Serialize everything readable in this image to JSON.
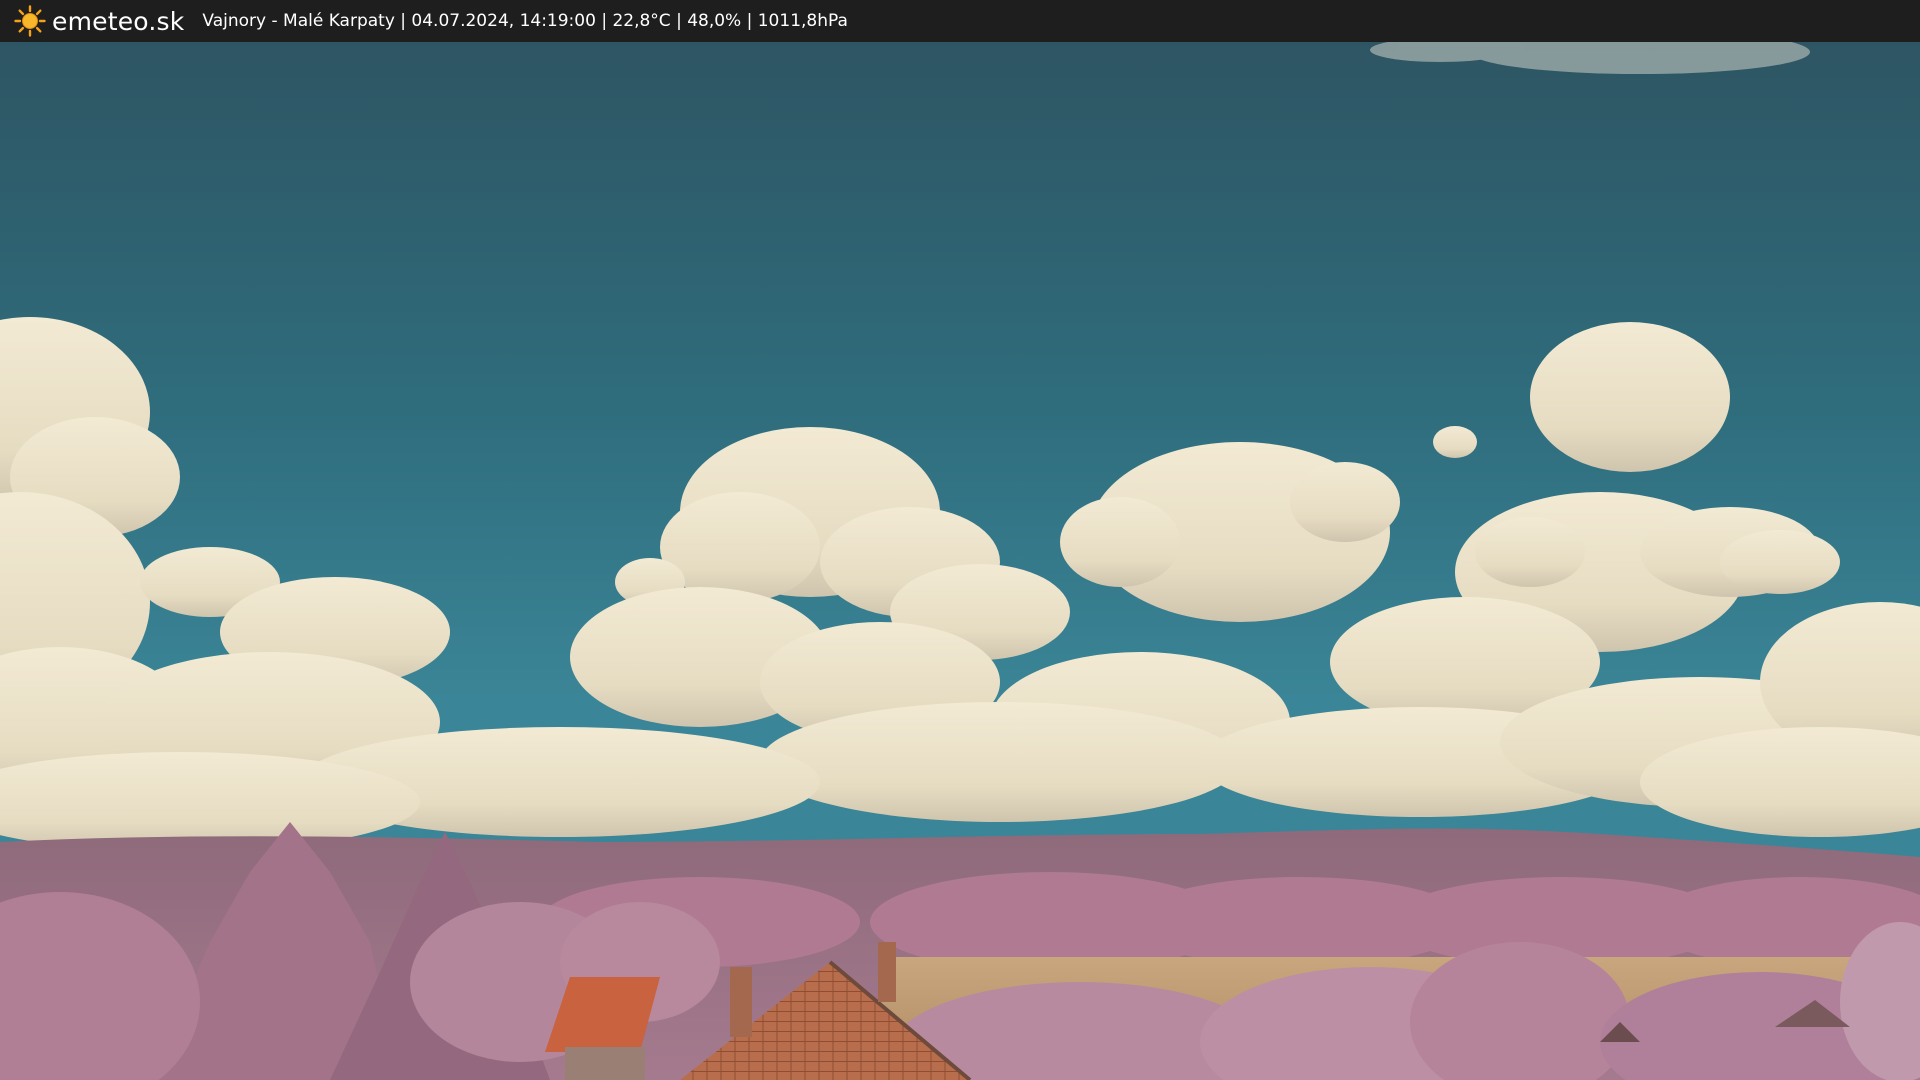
{
  "header": {
    "brand": "emeteo.sk",
    "brand_icon": "sun-icon",
    "caption": "Vajnory - Malé Karpaty | 04.07.2024, 14:19:00 | 22,8°C | 48,0% | 1011,8hPa"
  },
  "colors": {
    "bar_background": "#1e1e1e",
    "sun_orange": "#f5a21b",
    "sky_top": "#2f5967",
    "sky_bottom": "#2f7c8e",
    "cloud": "#ece3cd",
    "foliage": "#b77f97",
    "field": "#c6a47b",
    "roof": "#c45f3e"
  }
}
